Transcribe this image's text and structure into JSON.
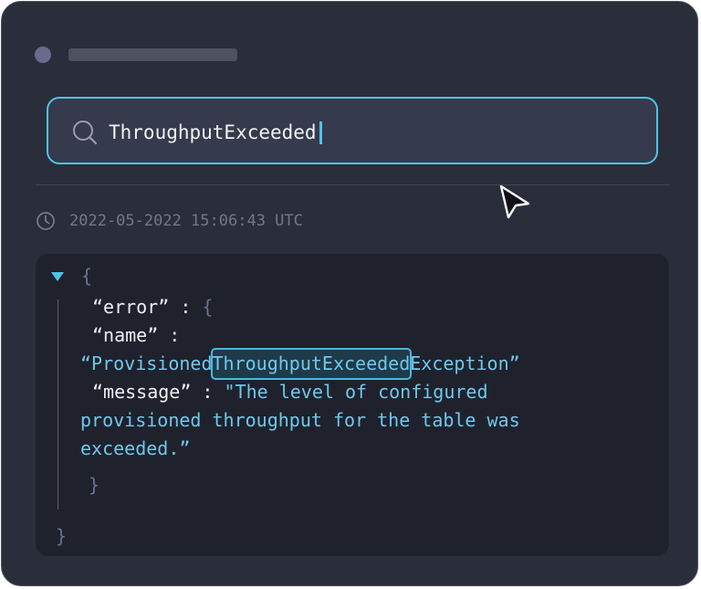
{
  "search": {
    "query": "ThroughputExceeded"
  },
  "log_entry": {
    "timestamp": "2022-05-2022 15:06:43 UTC",
    "json": {
      "open_brace": "{",
      "close_brace": "}",
      "error_key": "“error”",
      "colon": " : ",
      "error_open_brace": "{",
      "error_close_brace": "}",
      "name_key": "“name”",
      "name_colon": " :",
      "name_value_prefix": "“Provisioned",
      "name_value_match": "ThroughputExceeded",
      "name_value_suffix": "Exception”",
      "message_key": "“message”",
      "message_colon": " : ",
      "message_value_line1": "\"The level of configured",
      "message_value_line2": "provisioned throughput for the table was",
      "message_value_line3": "exceeded.”"
    }
  },
  "colors": {
    "accent": "#4fc3e8",
    "background": "#2a2e3b",
    "panel": "#1f222d",
    "string": "#71c7ea"
  },
  "icons": {
    "search": "search-icon",
    "clock": "clock-icon",
    "cursor": "cursor-icon",
    "toggle": "caret-down-icon"
  }
}
